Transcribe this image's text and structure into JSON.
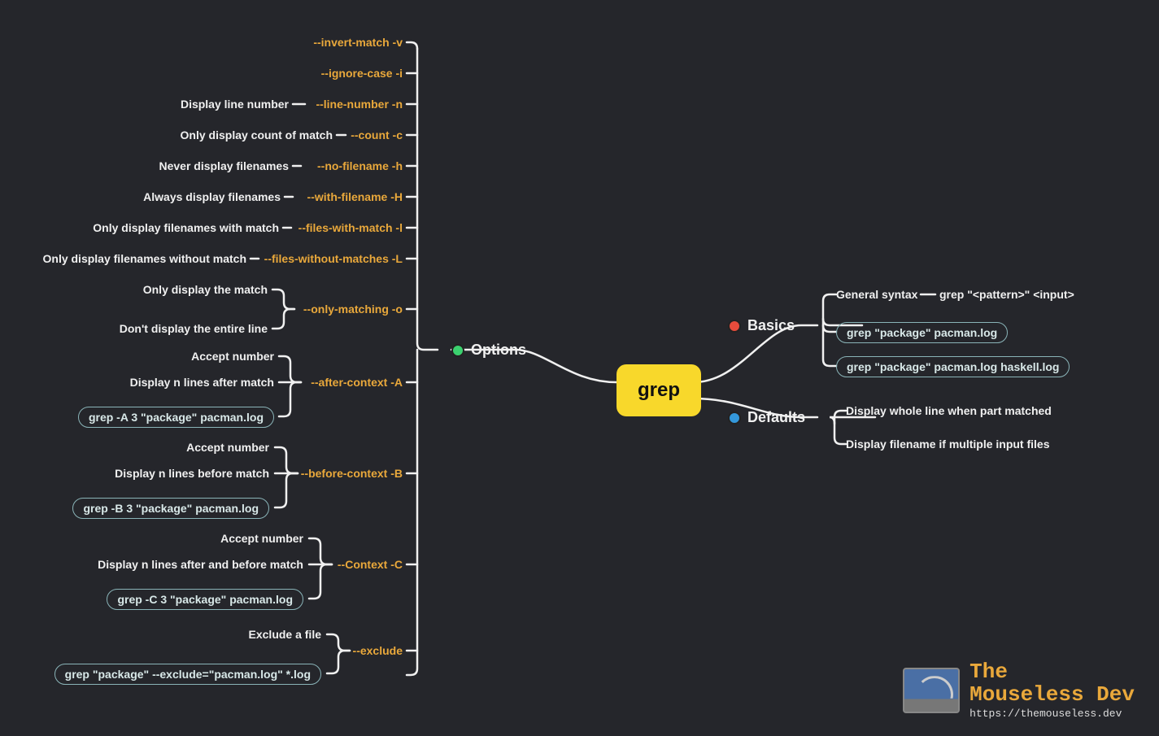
{
  "root": {
    "label": "grep"
  },
  "branches": {
    "options": {
      "label": "Options"
    },
    "basics": {
      "label": "Basics"
    },
    "defaults": {
      "label": "Defaults"
    }
  },
  "basics": {
    "syntax_label": "General syntax",
    "syntax_value": "grep \"<pattern>\" <input>",
    "ex1": "grep \"package\" pacman.log",
    "ex2": "grep \"package\" pacman.log haskell.log"
  },
  "defaults": {
    "d1": "Display whole line when part matched",
    "d2": "Display filename if multiple input files"
  },
  "options": {
    "invert": {
      "flag": "--invert-match -v"
    },
    "ignore": {
      "flag": "--ignore-case -i"
    },
    "linen": {
      "flag": "--line-number -n",
      "desc": "Display line number"
    },
    "count": {
      "flag": "--count -c",
      "desc": "Only display count of match"
    },
    "nofile": {
      "flag": "--no-filename -h",
      "desc": "Never display filenames"
    },
    "withfile": {
      "flag": "--with-filename -H",
      "desc": "Always display filenames"
    },
    "fwm": {
      "flag": "--files-with-match -l",
      "desc": "Only display filenames with match"
    },
    "fwom": {
      "flag": "--files-without-matches -L",
      "desc": "Only display filenames without match"
    },
    "only": {
      "flag": "--only-matching -o",
      "d1": "Only display the match",
      "d2": "Don't display the entire line"
    },
    "after": {
      "flag": "--after-context -A",
      "d1": "Accept number",
      "d2": "Display n lines after match",
      "ex": "grep -A 3 \"package\" pacman.log"
    },
    "before": {
      "flag": "--before-context -B",
      "d1": "Accept number",
      "d2": "Display n lines before match",
      "ex": "grep -B 3 \"package\" pacman.log"
    },
    "context": {
      "flag": "--Context -C",
      "d1": "Accept number",
      "d2": "Display n lines after and before match",
      "ex": "grep -C 3 \"package\" pacman.log"
    },
    "exclude": {
      "flag": "--exclude",
      "d1": "Exclude a file",
      "ex": "grep \"package\" --exclude=\"pacman.log\" *.log"
    }
  },
  "footer": {
    "title1": "The",
    "title2": "Mouseless Dev",
    "url": "https://themouseless.dev"
  }
}
